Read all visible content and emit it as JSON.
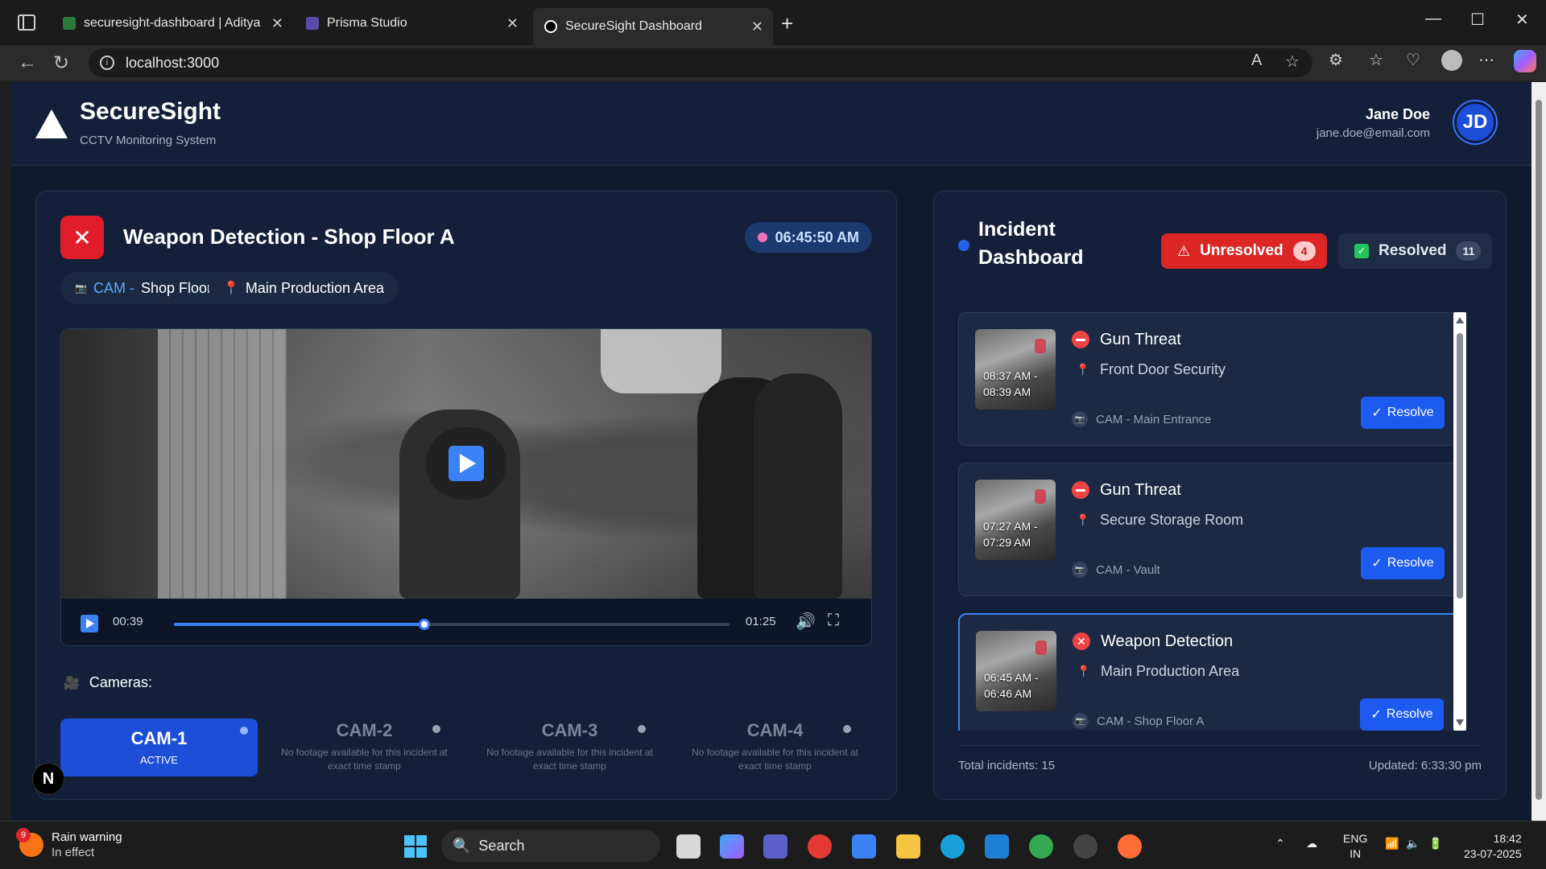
{
  "browser": {
    "tabs": [
      {
        "title": "securesight-dashboard | AdityaBD",
        "favicon_color": "#2a7a3a"
      },
      {
        "title": "Prisma Studio",
        "favicon_color": "#5b4aa8"
      },
      {
        "title": "SecureSight Dashboard",
        "favicon_color": "#ffffff",
        "active": true
      }
    ],
    "url": "localhost:3000"
  },
  "header": {
    "brand": "SecureSight",
    "subtitle": "CCTV Monitoring System",
    "user_name": "Jane Doe",
    "user_email": "jane.doe@email.com",
    "avatar_initials": "JD"
  },
  "incident": {
    "title": "Weapon Detection - Shop Floor A",
    "time": "06:45:50 AM",
    "camera_prefix": "CAM -",
    "camera_name": "Shop Floor A",
    "location": "Main Production Area"
  },
  "player": {
    "current_time": "00:39",
    "duration": "01:25",
    "progress_fraction": 0.45
  },
  "cameras": {
    "label": "Cameras:",
    "items": [
      {
        "name": "CAM-1",
        "status": "ACTIVE"
      },
      {
        "name": "CAM-2",
        "status": "No footage available for this incident at exact time stamp"
      },
      {
        "name": "CAM-3",
        "status": "No footage available for this incident at exact time stamp"
      },
      {
        "name": "CAM-4",
        "status": "No footage available for this incident at exact time stamp"
      }
    ]
  },
  "dashboard": {
    "title": "Incident Dashboard",
    "unresolved_label": "Unresolved",
    "unresolved_count": "4",
    "resolved_label": "Resolved",
    "resolved_count": "11",
    "incidents": [
      {
        "type": "Gun Threat",
        "location": "Front Door Security",
        "camera": "CAM - Main Entrance",
        "time_start": "08:37 AM -",
        "time_end": "08:39 AM",
        "action": "Resolve"
      },
      {
        "type": "Gun Threat",
        "location": "Secure Storage Room",
        "camera": "CAM - Vault",
        "time_start": "07:27 AM -",
        "time_end": "07:29 AM",
        "action": "Resolve"
      },
      {
        "type": "Weapon Detection",
        "location": "Main Production Area",
        "camera": "CAM - Shop Floor A",
        "time_start": "06:45 AM -",
        "time_end": "06:46 AM",
        "action": "Resolve"
      }
    ],
    "total": "Total incidents: 15",
    "updated": "Updated: 6:33:30 pm"
  },
  "taskbar": {
    "weather_title": "Rain warning",
    "weather_sub": "In effect",
    "weather_badge": "9",
    "search": "Search",
    "lang1": "ENG",
    "lang2": "IN",
    "clock_time": "18:42",
    "clock_date": "23-07-2025"
  },
  "misc": {
    "dev_badge": "N"
  },
  "colors": {
    "accent": "#1d4ed8",
    "danger": "#dc2626",
    "panel": "#14203a",
    "background": "#0f1a2d"
  }
}
